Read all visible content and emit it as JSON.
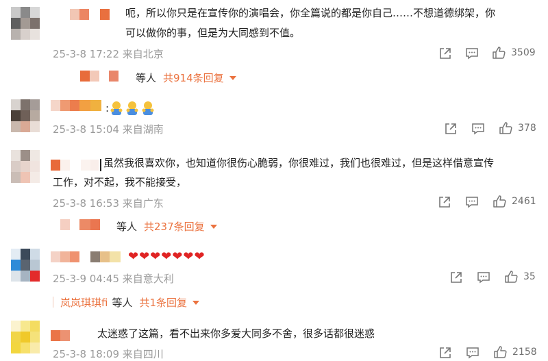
{
  "comments": [
    {
      "text": "呃，所以你只是在宣传你的演唱会，你全篇说的都是你自己……不想道德绑架，你",
      "text2": "可以做你的事，但是为大同感到不值。",
      "meta": "25-3-8 17:22 来自北京",
      "likes": "3509",
      "reply": {
        "label": "等人",
        "count": "共914条回复"
      }
    },
    {
      "text": ":",
      "meta": "25-3-8 15:04 来自湖南",
      "likes": "378"
    },
    {
      "text": "虽然我很喜欢你，也知道你很伤心脆弱，你很难过，我们也很难过，但是这样借意宣传",
      "text2": "工作，对不起，我不能接受，",
      "meta": "25-3-8 16:53 来自广东",
      "likes": "2461",
      "reply": {
        "label": "等人",
        "count": "共237条回复"
      }
    },
    {
      "text": "❤❤❤❤❤❤❤",
      "meta": "25-3-9 04:45 来自意大利",
      "likes": "35",
      "reply": {
        "name": "岚岚琪琪fi",
        "label": "等人",
        "count": "共1条回复"
      }
    },
    {
      "text": "太迷惑了这篇，看不出来你多爱大同多不舍，很多话都很迷惑",
      "meta": "25-3-8 18:09 来自四川",
      "likes": "2158"
    }
  ],
  "icons": {
    "share": "share-icon",
    "comment": "comment-icon",
    "like": "thumbs-up-icon"
  },
  "colors": {
    "accent": "#eb7340",
    "meta": "#9a9a9a",
    "heart": "#e02424"
  }
}
